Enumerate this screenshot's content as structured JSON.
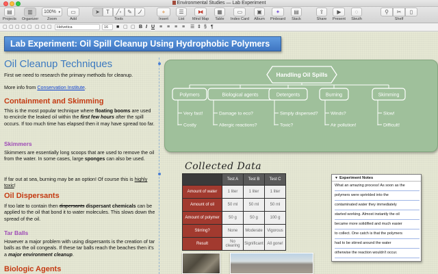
{
  "window": {
    "title": "Environmental Studies — Lab Experiment"
  },
  "toolbar": {
    "projects": "Projects",
    "organizer": "Organizer",
    "zoom_value": "100%",
    "zoom": "Zoom",
    "add": "Add",
    "tools": "Tools",
    "insert": "Insert",
    "list": "List",
    "mind_map": "Mind Map",
    "table": "Table",
    "index_card": "Index Card",
    "album": "Album",
    "pinboard": "Pinboard",
    "stack": "Stack",
    "share": "Share",
    "present": "Present",
    "sleuth": "Sleuth",
    "shelf": "Shelf"
  },
  "format": {
    "font": "Helvetica",
    "size": "16",
    "bold": "B",
    "italic": "I",
    "underline": "U",
    "paragraph": "¶"
  },
  "banner": {
    "title": "Lab Experiment: Oil Spill Cleanup Using Hydrophobic Polymers"
  },
  "text": {
    "heading": "Oil Cleanup Techniques",
    "intro": "First we need to research the primary methods for cleanup.",
    "more_info_prefix": "More info from ",
    "more_info_link": "Conservation Institute",
    "more_info_suffix": ".",
    "h_containment": "Containment and Skimming",
    "containment_a": "This is the most popular technique where ",
    "containment_b": "floating booms",
    "containment_c": " are used to encircle the leaked oil within the ",
    "containment_d": "first few hours",
    "containment_e": " after the spill occurs. If too much time has elapsed then it may have spread too far.",
    "h_skimmers": "Skimmers",
    "skimmers_a": "Skimmers are essentially long scoops that are used to remove the oil from the water. In some cases, large ",
    "skimmers_b": "sponges",
    "skimmers_c": " can also be used.",
    "burning_a": "If far out at sea, burning may be an option! Of course this is ",
    "burning_b": "highly toxic",
    "burning_c": "!",
    "h_dispersants": "Oil Dispersants",
    "disp_a": "If too late to contain then ",
    "disp_b": "dispersants",
    "disp_c": " ",
    "disp_d": "dispersant chemicals",
    "disp_e": " can be applied to the oil that bond it to water molecules. This slows down the spread of the oil.",
    "h_tarballs": "Tar Balls",
    "tar_a": "However a major problem with using dispersants is the creation of tar balls as the oil congeals. If these tar balls reach the beaches then it's a ",
    "tar_b": "major environment cleanup",
    "tar_c": ".",
    "h_bio": "Biologic Agents"
  },
  "mindmap": {
    "root": "Handling Oil Spills",
    "branches": [
      {
        "label": "Polymers",
        "items": [
          "Very fast!",
          "Costly"
        ]
      },
      {
        "label": "Biological agents",
        "items": [
          "Damage to eco?",
          "Allergic reactions?"
        ]
      },
      {
        "label": "Detergents",
        "items": [
          "Simply dispersed?",
          "Toxic?"
        ]
      },
      {
        "label": "Burning",
        "items": [
          "Winds?",
          "Air pollution!"
        ]
      },
      {
        "label": "Skimming",
        "items": [
          "Slow!",
          "Difficult!"
        ]
      }
    ]
  },
  "collected": {
    "title": "Collected Data",
    "headers": [
      "Test A",
      "Test B",
      "Test C"
    ],
    "rows": [
      {
        "label": "Amount of water",
        "values": [
          "1 liter",
          "1 liter",
          "1 liter"
        ]
      },
      {
        "label": "Amount of oil",
        "values": [
          "50 ml",
          "50 ml",
          "50 ml"
        ]
      },
      {
        "label": "Amount of polymer",
        "values": [
          "50 g",
          "50 g",
          "100 g"
        ]
      },
      {
        "label": "Stirring?",
        "values": [
          "None",
          "Moderate",
          "Vigorous"
        ]
      },
      {
        "label": "Result",
        "values": [
          "No clearing",
          "Significant",
          "All gone!"
        ]
      }
    ]
  },
  "notes": {
    "title": "Experiment Notes",
    "lines": [
      "What an amazing process! As soon as the",
      "polymers were sprinkled into the",
      "contaminated water they immediately",
      "started working. Almost instantly the oil",
      "became more solidified and much easier",
      "to collect. One catch is that the polymers",
      "had to be stirred around the water",
      "otherwise the reaction wouldn't occur."
    ]
  },
  "colors": {
    "banner": "#4a86d0",
    "heading_blue": "#3c79c0",
    "section_red": "#c43a12",
    "subsection_purple": "#9e4bb6",
    "mindmap_green": "#9fc09b",
    "table_rowhead": "#a23a2f",
    "link": "#0b3fd1"
  }
}
